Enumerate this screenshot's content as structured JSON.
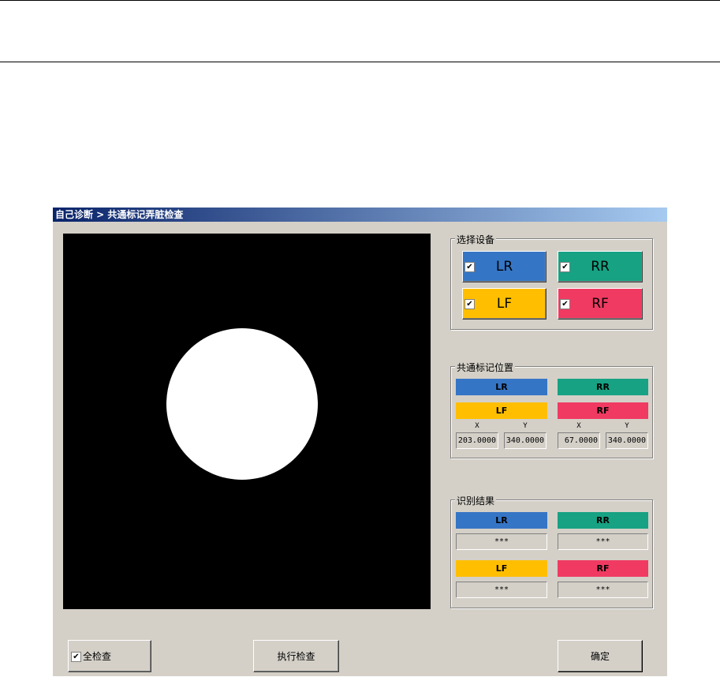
{
  "window": {
    "title": "自己诊断 > 共通标记弄脏检查"
  },
  "colors": {
    "LR": "#3575c5",
    "RR": "#16a283",
    "LF": "#ffbf00",
    "RF": "#f03a62"
  },
  "select_devices": {
    "label": "选择设备",
    "buttons": [
      {
        "label": "LR",
        "checked": true
      },
      {
        "label": "RR",
        "checked": true
      },
      {
        "label": "LF",
        "checked": true
      },
      {
        "label": "RF",
        "checked": true
      }
    ]
  },
  "mark_position": {
    "label": "共通标记位置",
    "tags": [
      "LR",
      "RR",
      "LF",
      "RF"
    ],
    "x_label": "X",
    "y_label": "Y",
    "left": {
      "x": "203.0000",
      "y": "340.0000"
    },
    "right": {
      "x": "67.0000",
      "y": "340.0000"
    }
  },
  "results": {
    "label": "识别结果",
    "items": [
      {
        "label": "LR",
        "value": "***"
      },
      {
        "label": "RR",
        "value": "***"
      },
      {
        "label": "LF",
        "value": "***"
      },
      {
        "label": "RF",
        "value": "***"
      }
    ]
  },
  "footer": {
    "check_all": "全检查",
    "check_all_checked": true,
    "execute": "执行检查",
    "ok": "确定"
  },
  "check_mark": "✔"
}
